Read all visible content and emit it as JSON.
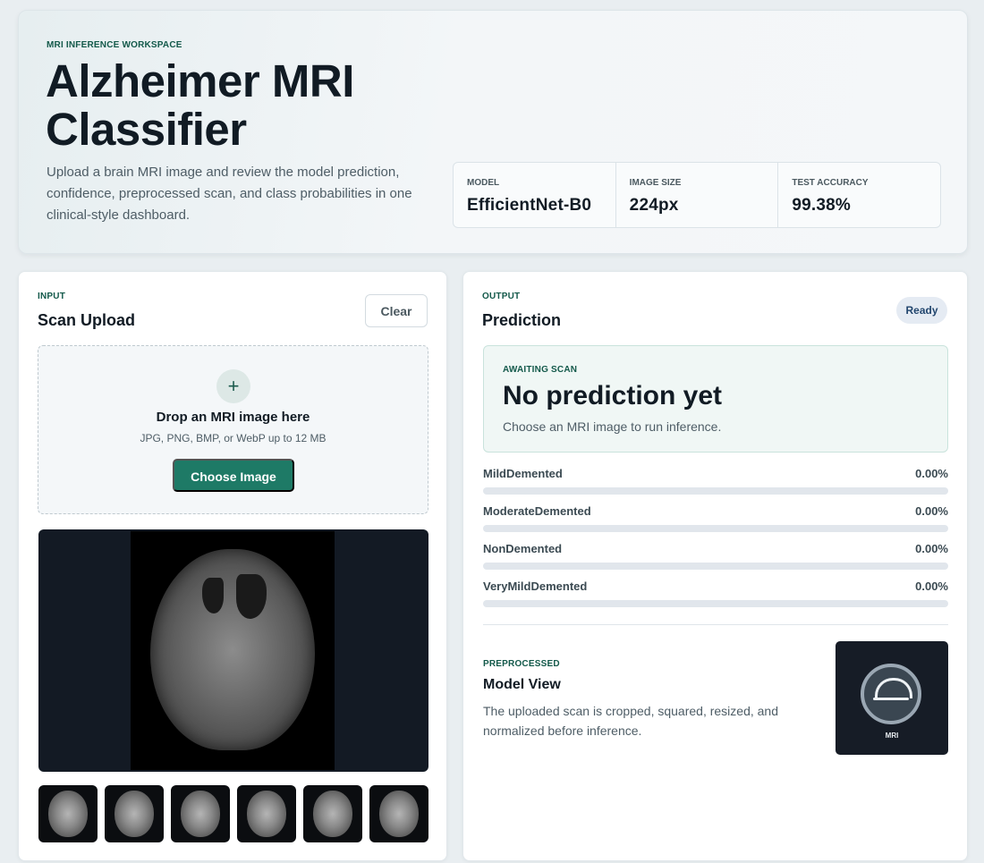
{
  "hero": {
    "eyebrow": "MRI INFERENCE WORKSPACE",
    "title": "Alzheimer MRI Classifier",
    "description": "Upload a brain MRI image and review the model prediction, confidence, preprocessed scan, and class probabilities in one clinical-style dashboard.",
    "stats": [
      {
        "label": "MODEL",
        "value": "EfficientNet-B0"
      },
      {
        "label": "IMAGE SIZE",
        "value": "224px"
      },
      {
        "label": "TEST ACCURACY",
        "value": "99.38%"
      }
    ]
  },
  "input_panel": {
    "eyebrow": "INPUT",
    "title": "Scan Upload",
    "clear_label": "Clear",
    "dropzone": {
      "plus": "+",
      "title": "Drop an MRI image here",
      "subtitle": "JPG, PNG, BMP, or WebP up to 12 MB",
      "button_label": "Choose Image"
    },
    "thumbnail_count": 6
  },
  "output_panel": {
    "eyebrow": "OUTPUT",
    "title": "Prediction",
    "status": "Ready",
    "awaiting": {
      "eyebrow": "AWAITING SCAN",
      "headline": "No prediction yet",
      "message": "Choose an MRI image to run inference."
    },
    "probabilities": [
      {
        "label": "MildDemented",
        "value_text": "0.00%",
        "fraction": 0
      },
      {
        "label": "ModerateDemented",
        "value_text": "0.00%",
        "fraction": 0
      },
      {
        "label": "NonDemented",
        "value_text": "0.00%",
        "fraction": 0
      },
      {
        "label": "VeryMildDemented",
        "value_text": "0.00%",
        "fraction": 0
      }
    ],
    "preprocessed": {
      "eyebrow": "PREPROCESSED",
      "title": "Model View",
      "description": "The uploaded scan is cropped, squared, resized, and normalized before inference.",
      "placeholder_label": "MRI"
    }
  },
  "colors": {
    "accent": "#1e7a66",
    "eyebrow": "#13594a",
    "ready_badge": "#e5ebf3"
  }
}
